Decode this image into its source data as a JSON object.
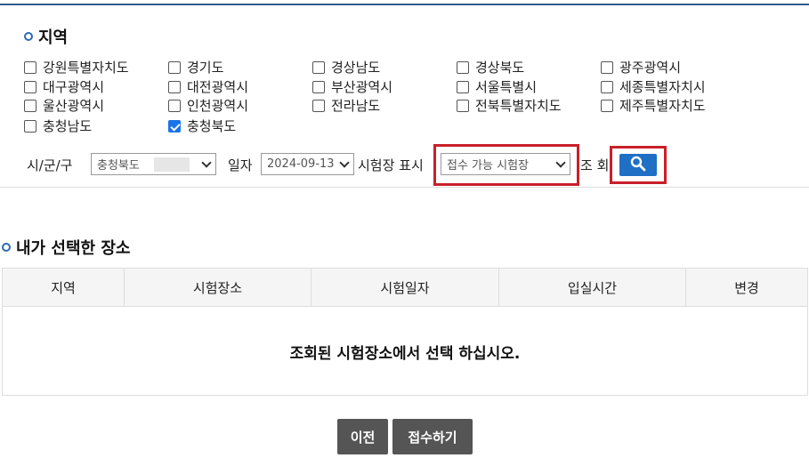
{
  "region": {
    "title": "지역",
    "items": [
      {
        "label": "강원특별자치도",
        "checked": false
      },
      {
        "label": "경기도",
        "checked": false
      },
      {
        "label": "경상남도",
        "checked": false
      },
      {
        "label": "경상북도",
        "checked": false
      },
      {
        "label": "광주광역시",
        "checked": false
      },
      {
        "label": "대구광역시",
        "checked": false
      },
      {
        "label": "대전광역시",
        "checked": false
      },
      {
        "label": "부산광역시",
        "checked": false
      },
      {
        "label": "서울특별시",
        "checked": false
      },
      {
        "label": "세종특별자치시",
        "checked": false
      },
      {
        "label": "울산광역시",
        "checked": false
      },
      {
        "label": "인천광역시",
        "checked": false
      },
      {
        "label": "전라남도",
        "checked": false
      },
      {
        "label": "전북특별자치도",
        "checked": false
      },
      {
        "label": "제주특별자치도",
        "checked": false
      },
      {
        "label": "충청남도",
        "checked": false
      },
      {
        "label": "충청북도",
        "checked": true
      }
    ]
  },
  "filters": {
    "district_label": "시/군/구",
    "district_value": "충청북도",
    "date_label": "일자",
    "date_value": "2024-09-13",
    "display_label": "시험장 표시",
    "display_value": "접수 가능 시험장",
    "search_label": "조 회",
    "search_icon": "search-icon"
  },
  "my_selection": {
    "title": "내가 선택한 장소",
    "columns": [
      "지역",
      "시험장소",
      "시험일자",
      "입실시간",
      "변경"
    ],
    "empty_message": "조회된 시험장소에서 선택 하십시오."
  },
  "actions": {
    "prev_label": "이전",
    "submit_label": "접수하기"
  },
  "colors": {
    "accent": "#1f6fc5",
    "highlight": "#c8202a",
    "button": "#555555"
  }
}
